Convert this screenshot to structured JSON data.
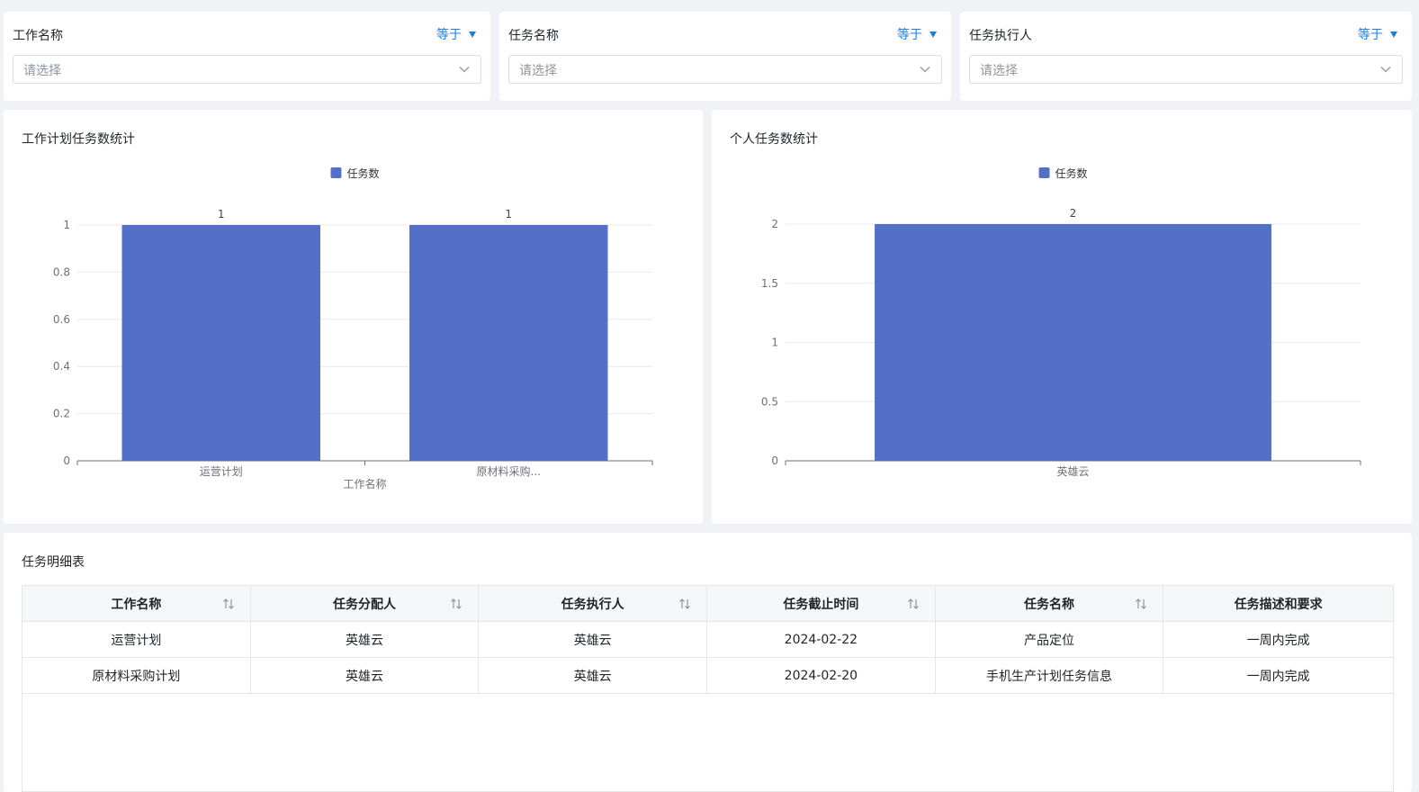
{
  "filters": [
    {
      "title": "工作名称",
      "operator": "等于",
      "placeholder": "请选择"
    },
    {
      "title": "任务名称",
      "operator": "等于",
      "placeholder": "请选择"
    },
    {
      "title": "任务执行人",
      "operator": "等于",
      "placeholder": "请选择"
    }
  ],
  "charts": {
    "work_plan": {
      "title": "工作计划任务数统计"
    },
    "personal": {
      "title": "个人任务数统计"
    }
  },
  "chart_data": [
    {
      "type": "bar",
      "title": "工作计划任务数统计",
      "legend": [
        "任务数"
      ],
      "legend_position": "top-center",
      "categories": [
        "运营计划",
        "原材料采购..."
      ],
      "series": [
        {
          "name": "任务数",
          "values": [
            1,
            1
          ]
        }
      ],
      "xlabel": "工作名称",
      "ylabel": "",
      "ylim": [
        0,
        1
      ],
      "yticks": [
        "0",
        "0.2",
        "0.4",
        "0.6",
        "0.8",
        "1"
      ],
      "data_labels": [
        "1",
        "1"
      ],
      "grid": true,
      "color": "#5470c6"
    },
    {
      "type": "bar",
      "title": "个人任务数统计",
      "legend": [
        "任务数"
      ],
      "legend_position": "top-center",
      "categories": [
        "英雄云"
      ],
      "series": [
        {
          "name": "任务数",
          "values": [
            2
          ]
        }
      ],
      "xlabel": "",
      "ylabel": "",
      "ylim": [
        0,
        2
      ],
      "yticks": [
        "0",
        "0.5",
        "1",
        "1.5",
        "2"
      ],
      "data_labels": [
        "2"
      ],
      "grid": true,
      "color": "#5470c6"
    }
  ],
  "table": {
    "title": "任务明细表",
    "columns": [
      "工作名称",
      "任务分配人",
      "任务执行人",
      "任务截止时间",
      "任务名称",
      "任务描述和要求"
    ],
    "sortable": [
      true,
      true,
      true,
      true,
      true,
      false
    ],
    "rows": [
      [
        "运营计划",
        "英雄云",
        "英雄云",
        "2024-02-22",
        "产品定位",
        "一周内完成"
      ],
      [
        "原材料采购计划",
        "英雄云",
        "英雄云",
        "2024-02-20",
        "手机生产计划任务信息",
        "一周内完成"
      ]
    ]
  },
  "colors": {
    "accent": "#1e7ce6",
    "bar": "#5470c6",
    "background": "#f1f2f5"
  }
}
